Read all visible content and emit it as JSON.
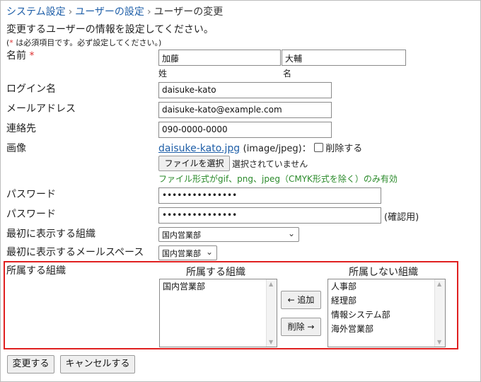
{
  "breadcrumb": {
    "items": [
      "システム設定",
      "ユーザーの設定"
    ],
    "current": "ユーザーの変更",
    "separator": "›"
  },
  "intro": "変更するユーザーの情報を設定してください。",
  "required_note": {
    "mark": "*",
    "text": " は必須項目です。必ず設定してください。)",
    "open": "("
  },
  "form": {
    "name": {
      "label": "名前",
      "required_mark": "*",
      "last_value": "加藤",
      "first_value": "大輔",
      "last_caption": "姓",
      "first_caption": "名"
    },
    "login": {
      "label": "ログイン名",
      "value": "daisuke-kato"
    },
    "email": {
      "label": "メールアドレス",
      "value": "daisuke-kato@example.com"
    },
    "contact": {
      "label": "連絡先",
      "value": "090-0000-0000"
    },
    "image": {
      "label": "画像",
      "file_name": "daisuke-kato.jpg",
      "file_type": "(image/jpeg)：",
      "delete_label": "削除する",
      "choose_button": "ファイルを選択",
      "no_file_text": "選択されていません",
      "note": "ファイル形式がgif、png、jpeg（CMYK形式を除く）のみ有効"
    },
    "password": {
      "label": "パスワード",
      "value": "•••••••••••••••"
    },
    "password_confirm": {
      "label": "パスワード",
      "value": "•••••••••••••••",
      "suffix": "(確認用)"
    },
    "first_org": {
      "label": "最初に表示する組織",
      "value": "国内営業部"
    },
    "first_mail_space": {
      "label": "最初に表示するメールスペース",
      "value": "国内営業部"
    },
    "orgs": {
      "label": "所属する組織",
      "member_heading": "所属する組織",
      "nonmember_heading": "所属しない組織",
      "member_list": [
        "国内営業部"
      ],
      "nonmember_list": [
        "人事部",
        "経理部",
        "情報システム部",
        "海外営業部"
      ],
      "add_button": "← 追加",
      "remove_button": "削除 →"
    }
  },
  "actions": {
    "submit": "変更する",
    "cancel": "キャンセルする"
  },
  "colors": {
    "link": "#1f5fa8",
    "required": "#d33333",
    "highlight_border": "#e02020",
    "note_green": "#2a8a2a"
  }
}
